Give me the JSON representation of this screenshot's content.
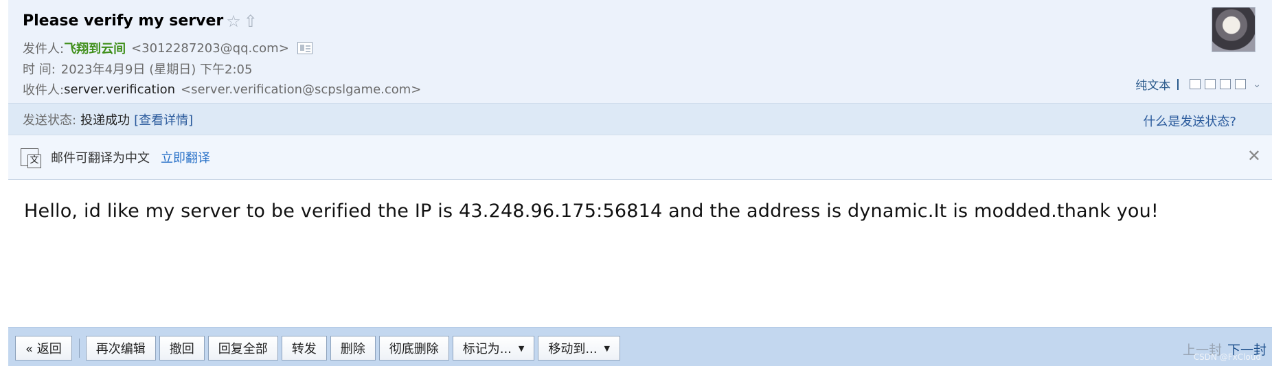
{
  "header": {
    "subject": "Please verify my server",
    "from_label": "发件人:",
    "from_name": "飞翔到云间",
    "from_addr": "<3012287203@qq.com>",
    "time_label": "时 间:",
    "time_value": "2023年4月9日 (星期日) 下午2:05",
    "to_label": "收件人:",
    "to_name": "server.verification",
    "to_addr": "<server.verification@scpslgame.com>",
    "plain_text": "纯文本"
  },
  "status": {
    "label": "发送状态:",
    "value": "投递成功",
    "details_link": "[查看详情]",
    "help_link": "什么是发送状态?"
  },
  "translate": {
    "text": "邮件可翻译为中文",
    "link": "立即翻译"
  },
  "body": {
    "text": "Hello, id like my server to be verified the IP is 43.248.96.175:56814 and the address is dynamic.It is modded.thank you!"
  },
  "actions": {
    "back": "« 返回",
    "reedit": "再次编辑",
    "recall": "撤回",
    "reply_all": "回复全部",
    "forward": "转发",
    "delete": "删除",
    "delete_permanent": "彻底删除",
    "mark_as": "标记为...",
    "move_to": "移动到..."
  },
  "pager": {
    "prev": "上一封",
    "next": "下一封"
  },
  "watermark": "CSDN @FxCloud",
  "icons": [
    "star-icon",
    "share-up-icon",
    "contact-card-icon",
    "avatar",
    "new-window-icon",
    "print-icon",
    "expand-chevron-icon",
    "translate-icon",
    "close-icon"
  ]
}
